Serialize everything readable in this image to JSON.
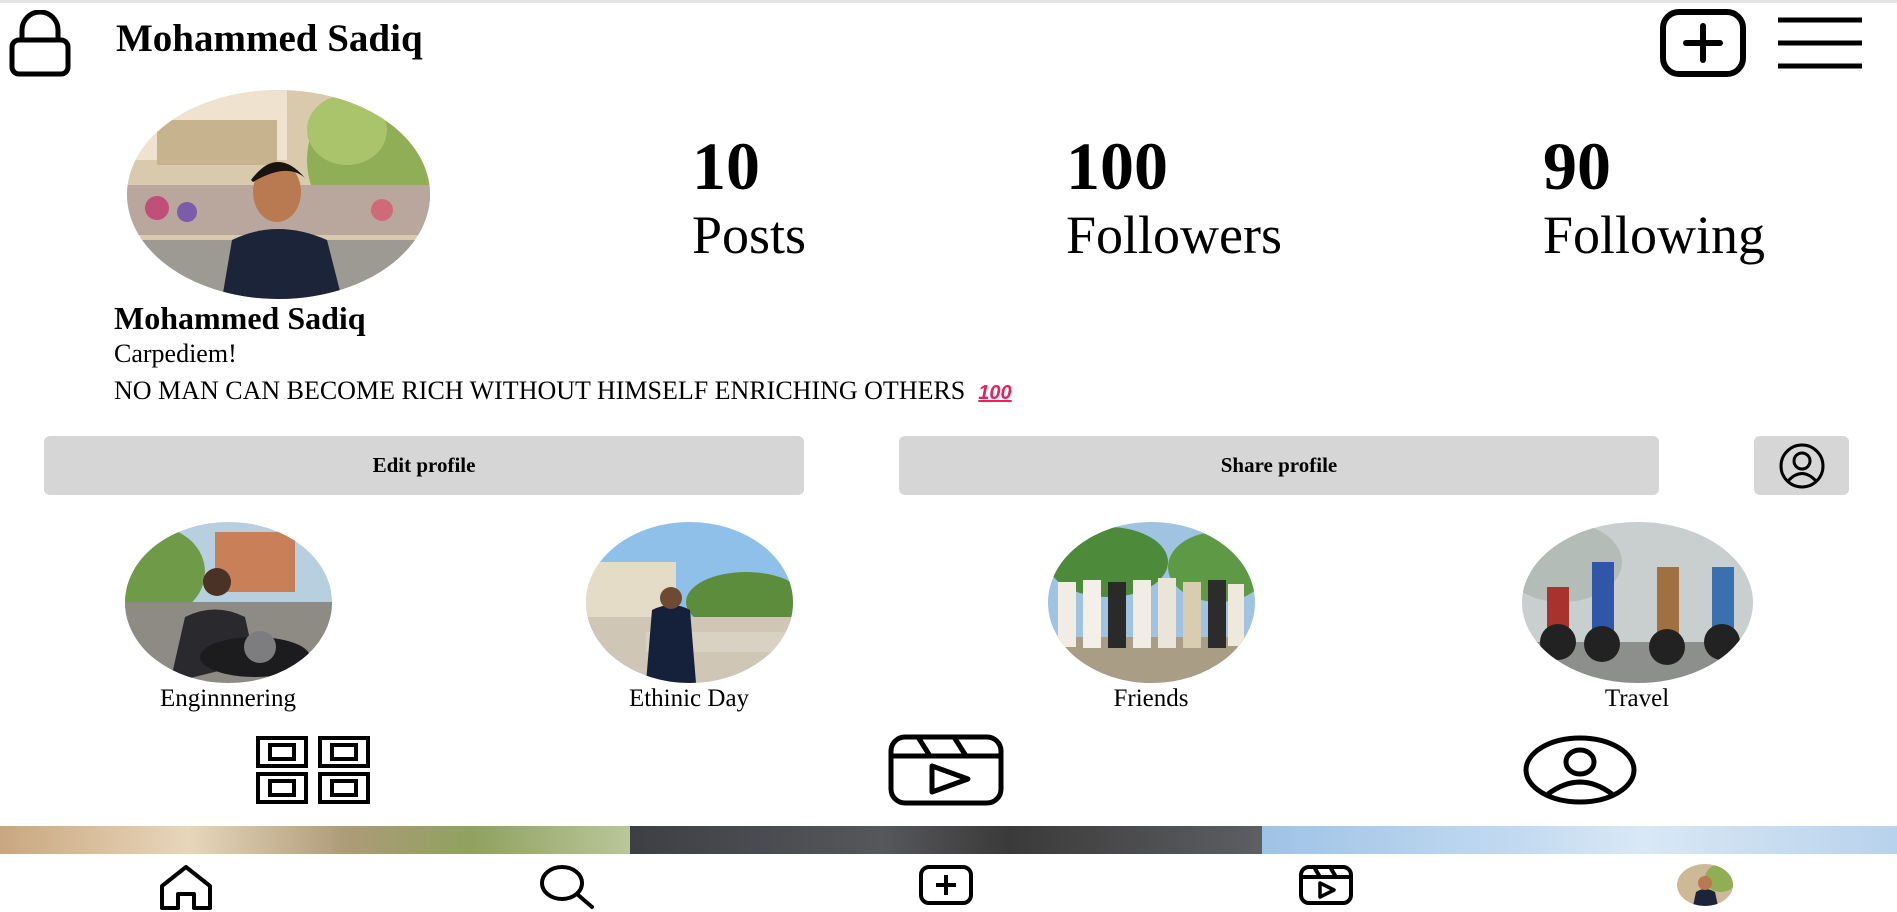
{
  "header": {
    "username": "Mohammed Sadiq",
    "icons": [
      "lock-icon",
      "plus-square-icon",
      "hamburger-menu-icon"
    ]
  },
  "stats": {
    "posts": {
      "count": "10",
      "label": "Posts"
    },
    "followers": {
      "count": "100",
      "label": "Followers"
    },
    "following": {
      "count": "90",
      "label": "Following"
    }
  },
  "bio": {
    "name": "Mohammed Sadiq",
    "line1": "Carpediem!",
    "line2": "NO MAN CAN BECOME RICH WITHOUT HIMSELF ENRICHING OTHERS",
    "emoji": "100"
  },
  "actions": {
    "edit_label": "Edit profile",
    "share_label": "Share profile"
  },
  "highlights": [
    {
      "label": "Enginnnering"
    },
    {
      "label": "Ethinic Day"
    },
    {
      "label": "Friends"
    },
    {
      "label": "Travel"
    }
  ],
  "tabs": [
    "grid-icon",
    "reels-icon",
    "tagged-icon"
  ],
  "bottom_nav": [
    "home-icon",
    "search-icon",
    "create-icon",
    "reels-icon",
    "profile-avatar"
  ],
  "colors": {
    "button_bg": "#d6d6d6",
    "emoji": "#e8215a"
  }
}
